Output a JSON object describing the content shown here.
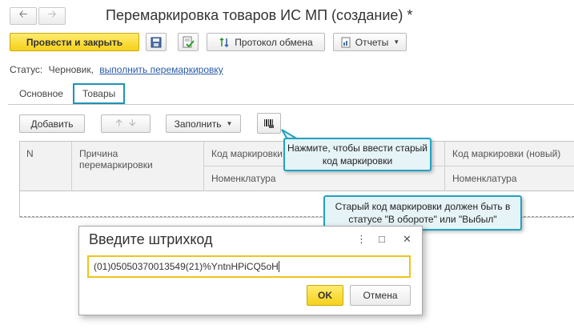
{
  "window": {
    "title": "Перемаркировка товаров ИС МП (создание) *",
    "back_icon": "arrow-left",
    "forward_icon": "arrow-right"
  },
  "toolbar": {
    "post_close_label": "Провести и закрыть",
    "save_icon": "floppy-disk",
    "post_icon": "document-post",
    "exchange_label": "Протокол обмена",
    "reports_label": "Отчеты"
  },
  "status": {
    "label": "Статус:",
    "value": "Черновик,",
    "action_link": "выполнить перемаркировку"
  },
  "tabs": [
    {
      "label": "Основное",
      "active": false
    },
    {
      "label": "Товары",
      "active": true
    }
  ],
  "table_toolbar": {
    "add_label": "Добавить",
    "fill_label": "Заполнить",
    "barcode_icon": "barcode-scanner"
  },
  "table": {
    "columns": [
      {
        "label": "N"
      },
      {
        "label": "Причина перемаркировки"
      },
      {
        "label": "Код маркировки",
        "sub_label": "Номенклатура"
      },
      {
        "label": "Код маркировки (новый)",
        "sub_label": "Номенклатура"
      }
    ],
    "rows": []
  },
  "callouts": {
    "barcode_hint": "Нажмите, чтобы ввести старый код маркировки",
    "status_hint": "Старый код маркировки должен быть в статусе \"В обороте\" или \"Выбыл\""
  },
  "dialog": {
    "title": "Введите штрихкод",
    "input_value": "(01)05050370013549(21)%YntnHPiCQ5oH",
    "ok_label": "OK",
    "cancel_label": "Отмена"
  }
}
